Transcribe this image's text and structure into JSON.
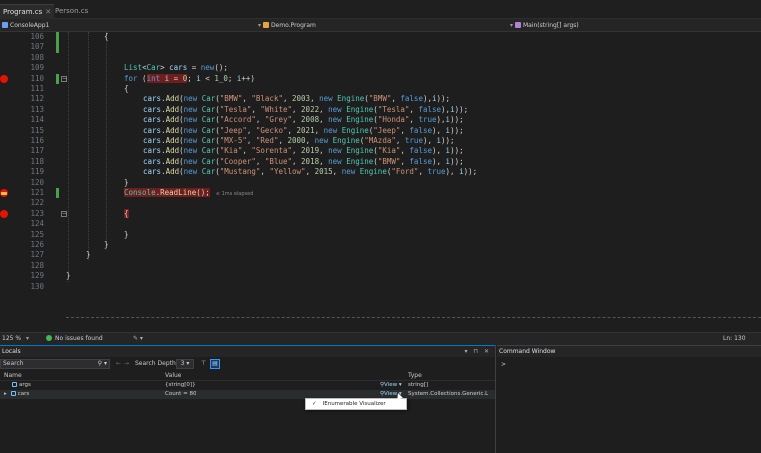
{
  "tabs": [
    {
      "label": "Program.cs",
      "active": true
    },
    {
      "label": "Person.cs",
      "active": false
    }
  ],
  "navbar": {
    "project": "ConsoleApp1",
    "type": "Demo.Program",
    "member": "Main(string[] args)"
  },
  "code_lines": [
    {
      "num": "106",
      "bp": "",
      "change": true,
      "fold": "",
      "indent": 104,
      "html": "{"
    },
    {
      "num": "107",
      "bp": "",
      "change": true,
      "fold": "",
      "indent": 104,
      "html": ""
    },
    {
      "num": "108",
      "bp": "",
      "change": false,
      "fold": "",
      "indent": 124,
      "html": ""
    },
    {
      "num": "109",
      "bp": "",
      "change": false,
      "fold": "",
      "indent": 124,
      "html": "<span class=\"t\">List</span>&lt;<span class=\"t\">Car</span>&gt; <span class=\"v\">cars</span> = <span class=\"k\">new</span>();"
    },
    {
      "num": "110",
      "bp": "bp",
      "change": true,
      "fold": "−",
      "indent": 124,
      "html": "<span class=\"k\">for</span> (<span class=\"hl\"><span class=\"k\">int</span> <span class=\"v\">i</span> = <span class=\"n\">0</span></span>; <span class=\"v\">i</span> &lt; <span class=\"n\">1_0</span>; <span class=\"v\">i</span>++)"
    },
    {
      "num": "111",
      "bp": "",
      "change": false,
      "fold": "",
      "indent": 124,
      "html": "{"
    },
    {
      "num": "112",
      "bp": "",
      "change": false,
      "fold": "",
      "indent": 143,
      "html": "<span class=\"v\">cars</span>.<span class=\"m\">Add</span>(<span class=\"k\">new</span> <span class=\"t\">Car</span>(<span class=\"s\">\"BMW\"</span>, <span class=\"s\">\"Black\"</span>, <span class=\"n\">2003</span>, <span class=\"k\">new</span> <span class=\"t\">Engine</span>(<span class=\"s\">\"BMW\"</span>, <span class=\"k\">false</span>),<span class=\"v\">i</span>));"
    },
    {
      "num": "113",
      "bp": "",
      "change": false,
      "fold": "",
      "indent": 143,
      "html": "<span class=\"v\">cars</span>.<span class=\"m\">Add</span>(<span class=\"k\">new</span> <span class=\"t\">Car</span>(<span class=\"s\">\"Tesla\"</span>, <span class=\"s\">\"White\"</span>, <span class=\"n\">2022</span>, <span class=\"k\">new</span> <span class=\"t\">Engine</span>(<span class=\"s\">\"Tesla\"</span>, <span class=\"k\">false</span>),<span class=\"v\">i</span>));"
    },
    {
      "num": "114",
      "bp": "",
      "change": false,
      "fold": "",
      "indent": 143,
      "html": "<span class=\"v\">cars</span>.<span class=\"m\">Add</span>(<span class=\"k\">new</span> <span class=\"t\">Car</span>(<span class=\"s\">\"Accord\"</span>, <span class=\"s\">\"Grey\"</span>, <span class=\"n\">2008</span>, <span class=\"k\">new</span> <span class=\"t\">Engine</span>(<span class=\"s\">\"Honda\"</span>, <span class=\"k\">true</span>),<span class=\"v\">i</span>));"
    },
    {
      "num": "115",
      "bp": "",
      "change": false,
      "fold": "",
      "indent": 143,
      "html": "<span class=\"v\">cars</span>.<span class=\"m\">Add</span>(<span class=\"k\">new</span> <span class=\"t\">Car</span>(<span class=\"s\">\"Jeep\"</span>, <span class=\"s\">\"Gecko\"</span>, <span class=\"n\">2021</span>, <span class=\"k\">new</span> <span class=\"t\">Engine</span>(<span class=\"s\">\"Jeep\"</span>, <span class=\"k\">false</span>), <span class=\"v\">i</span>));"
    },
    {
      "num": "116",
      "bp": "",
      "change": false,
      "fold": "",
      "indent": 143,
      "html": "<span class=\"v\">cars</span>.<span class=\"m\">Add</span>(<span class=\"k\">new</span> <span class=\"t\">Car</span>(<span class=\"s\">\"MX-5\"</span>, <span class=\"s\">\"Red\"</span>, <span class=\"n\">2000</span>, <span class=\"k\">new</span> <span class=\"t\">Engine</span>(<span class=\"s\">\"MAzda\"</span>, <span class=\"k\">true</span>), <span class=\"v\">i</span>));"
    },
    {
      "num": "117",
      "bp": "",
      "change": false,
      "fold": "",
      "indent": 143,
      "html": "<span class=\"v\">cars</span>.<span class=\"m\">Add</span>(<span class=\"k\">new</span> <span class=\"t\">Car</span>(<span class=\"s\">\"Kia\"</span>, <span class=\"s\">\"Sorenta\"</span>, <span class=\"n\">2019</span>, <span class=\"k\">new</span> <span class=\"t\">Engine</span>(<span class=\"s\">\"Kia\"</span>, <span class=\"k\">false</span>), <span class=\"v\">i</span>));"
    },
    {
      "num": "118",
      "bp": "",
      "change": false,
      "fold": "",
      "indent": 143,
      "html": "<span class=\"v\">cars</span>.<span class=\"m\">Add</span>(<span class=\"k\">new</span> <span class=\"t\">Car</span>(<span class=\"s\">\"Cooper\"</span>, <span class=\"s\">\"Blue\"</span>, <span class=\"n\">2018</span>, <span class=\"k\">new</span> <span class=\"t\">Engine</span>(<span class=\"s\">\"BMW\"</span>, <span class=\"k\">false</span>), <span class=\"v\">i</span>));"
    },
    {
      "num": "119",
      "bp": "",
      "change": false,
      "fold": "",
      "indent": 143,
      "html": "<span class=\"v\">cars</span>.<span class=\"m\">Add</span>(<span class=\"k\">new</span> <span class=\"t\">Car</span>(<span class=\"s\">\"Mustang\"</span>, <span class=\"s\">\"Yellow\"</span>, <span class=\"n\">2015</span>, <span class=\"k\">new</span> <span class=\"t\">Engine</span>(<span class=\"s\">\"Ford\"</span>, <span class=\"k\">true</span>), <span class=\"v\">i</span>));"
    },
    {
      "num": "120",
      "bp": "",
      "change": false,
      "fold": "",
      "indent": 124,
      "html": "}"
    },
    {
      "num": "121",
      "bp": "cur",
      "change": true,
      "fold": "",
      "indent": 124,
      "html": "<span class=\"hl\"><span class=\"t\">Console</span>.<span class=\"m\">ReadLine</span>();</span><span class=\"elapsed\">≤ 1ms elapsed</span>"
    },
    {
      "num": "122",
      "bp": "",
      "change": false,
      "fold": "",
      "indent": 124,
      "html": ""
    },
    {
      "num": "123",
      "bp": "bp",
      "change": false,
      "fold": "−",
      "indent": 124,
      "html": "<span class=\"hl\">{</span>"
    },
    {
      "num": "124",
      "bp": "",
      "change": false,
      "fold": "",
      "indent": 124,
      "html": ""
    },
    {
      "num": "125",
      "bp": "",
      "change": false,
      "fold": "",
      "indent": 124,
      "html": "}"
    },
    {
      "num": "126",
      "bp": "",
      "change": false,
      "fold": "",
      "indent": 104,
      "html": "}"
    },
    {
      "num": "127",
      "bp": "",
      "change": false,
      "fold": "",
      "indent": 86,
      "html": "}"
    },
    {
      "num": "128",
      "bp": "",
      "change": false,
      "fold": "",
      "indent": 86,
      "html": ""
    },
    {
      "num": "129",
      "bp": "",
      "change": false,
      "fold": "",
      "indent": 66,
      "html": "}"
    },
    {
      "num": "130",
      "bp": "",
      "change": false,
      "fold": "",
      "indent": 66,
      "html": ""
    }
  ],
  "status": {
    "zoom": "125 %",
    "issues": "No issues found",
    "position": "Ln: 130"
  },
  "locals": {
    "title": "Locals",
    "search_placeholder": "Search",
    "depth_label": "Search Depth:",
    "depth_value": "3",
    "headers": {
      "name": "Name",
      "value": "Value",
      "type": "Type"
    },
    "rows": [
      {
        "name": "args",
        "value": "{string[0]}",
        "view": "View",
        "type": "string[]"
      },
      {
        "name": "cars",
        "value": "Count = 80",
        "view": "View",
        "type": "System.Collections.Generic.Li..."
      }
    ]
  },
  "popup": {
    "check": "✓",
    "label": "IEnumerable Visualizer"
  },
  "command_window": {
    "title": "Command Window",
    "prompt": ">"
  },
  "colors": {
    "accent": "#007acc",
    "breakpoint": "#e51400",
    "change_bar": "#48a048"
  }
}
